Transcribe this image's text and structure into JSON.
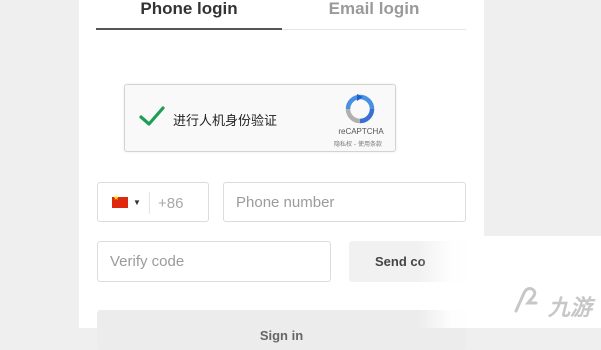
{
  "tabs": {
    "phone": "Phone login",
    "email": "Email login"
  },
  "recaptcha": {
    "label": "进行人机身份验证",
    "brand": "reCAPTCHA",
    "terms": "隐私权 - 使用条款"
  },
  "country": {
    "flag": "china-flag-icon",
    "dial_code": "+86"
  },
  "phone_input": {
    "placeholder": "Phone number"
  },
  "code_input": {
    "placeholder": "Verify code"
  },
  "send_button": {
    "label": "Send co"
  },
  "signin_button": {
    "label": "Sign in"
  },
  "watermark": {
    "text": "九游"
  },
  "colors": {
    "check": "#1f9d55",
    "flag_red": "#de2910",
    "tab_active": "#333333",
    "tab_inactive": "#9a9a9a"
  }
}
